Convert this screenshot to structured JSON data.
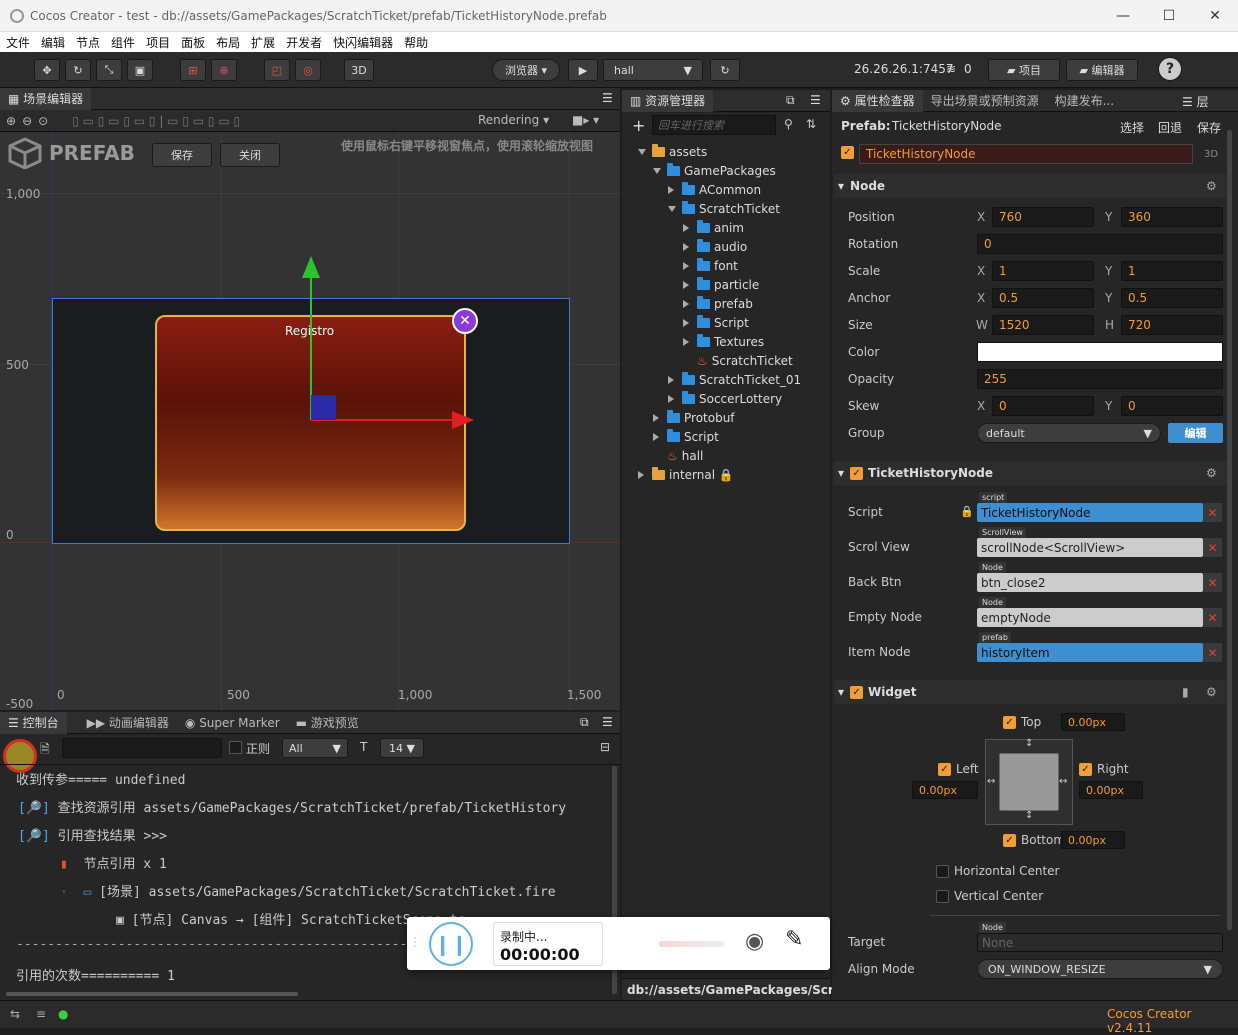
{
  "window": {
    "title": "Cocos Creator - test - db://assets/GamePackages/ScratchTicket/prefab/TicketHistoryNode.prefab"
  },
  "menu": [
    "文件",
    "编辑",
    "节点",
    "组件",
    "项目",
    "面板",
    "布局",
    "扩展",
    "开发者",
    "快闪编辑器",
    "帮助"
  ],
  "toolbar": {
    "mode3d": "3D",
    "browser": "浏览器",
    "scene_select": "hall",
    "ip": "26.26.26.1:7457",
    "wifi_count": "0",
    "project_btn": "项目",
    "editor_btn": "编辑器",
    "help": "?"
  },
  "scene_panel": {
    "tab": "场景编辑器",
    "rendering": "Rendering",
    "prefab_label": "PREFAB",
    "save": "保存",
    "close": "关闭",
    "hint": "使用鼠标右键平移视窗焦点，使用滚轮缩放视图",
    "axis_y": [
      "1,000",
      "500",
      "0",
      "-500"
    ],
    "axis_x": [
      "0",
      "500",
      "1,000",
      "1,500"
    ],
    "node_label": "Registro"
  },
  "console_panel": {
    "tabs": [
      "控制台",
      "动画编辑器",
      "Super Marker",
      "游戏预览"
    ],
    "regex": "正则",
    "filter": "All",
    "font_size": "14",
    "lines": [
      "收到传参===== undefined",
      "查找资源引用 assets/GamePackages/ScratchTicket/prefab/TicketHistory",
      "引用查找结果 >>>",
      "节点引用 x 1",
      "[场景] assets/GamePackages/ScratchTicket/ScratchTicket.fire",
      "[节点] Canvas  →  [组件] ScratchTicketScene.ts",
      "-------------------------------------------------------------",
      "引用的次数========== 1"
    ]
  },
  "assets_panel": {
    "tab": "资源管理器",
    "search_placeholder": "回车进行搜索",
    "tree": [
      "assets",
      "GamePackages",
      "ACommon",
      "ScratchTicket",
      "anim",
      "audio",
      "font",
      "particle",
      "prefab",
      "Script",
      "Textures",
      "ScratchTicket",
      "ScratchTicket_01",
      "SoccerLottery",
      "Protobuf",
      "Script",
      "hall",
      "internal"
    ],
    "footer": "db://assets/GamePackages/Scr..."
  },
  "inspector": {
    "tabs": [
      "属性检查器",
      "导出场景或预制资源",
      "构建发布..."
    ],
    "prefab_label": "Prefab:",
    "prefab_name": "TicketHistoryNode",
    "select": "选择",
    "revert": "回退",
    "save": "保存",
    "node_name": "TicketHistoryNode",
    "tag3d": "3D",
    "node_section": "Node",
    "position": {
      "label": "Position",
      "x": "760",
      "y": "360"
    },
    "rotation": {
      "label": "Rotation",
      "v": "0"
    },
    "scale": {
      "label": "Scale",
      "x": "1",
      "y": "1"
    },
    "anchor": {
      "label": "Anchor",
      "x": "0.5",
      "y": "0.5"
    },
    "size": {
      "label": "Size",
      "w": "1520",
      "h": "720"
    },
    "color": {
      "label": "Color"
    },
    "opacity": {
      "label": "Opacity",
      "v": "255"
    },
    "skew": {
      "label": "Skew",
      "x": "0",
      "y": "0"
    },
    "group": {
      "label": "Group",
      "v": "default",
      "edit": "编辑"
    },
    "comp_section": "TicketHistoryNode",
    "script": {
      "label": "Script",
      "tag": "script",
      "v": "TicketHistoryNode"
    },
    "scroll_view": {
      "label": "Scrol View",
      "tag": "ScrollView",
      "v": "scrollNode<ScrollView>"
    },
    "back_btn": {
      "label": "Back Btn",
      "tag": "Node",
      "v": "btn_close2"
    },
    "empty_node": {
      "label": "Empty Node",
      "tag": "Node",
      "v": "emptyNode"
    },
    "item_node": {
      "label": "Item Node",
      "tag": "prefab",
      "v": "historyItem"
    },
    "widget_section": "Widget",
    "widget": {
      "top": "Top",
      "top_v": "0.00px",
      "left": "Left",
      "left_v": "0.00px",
      "right": "Right",
      "right_v": "0.00px",
      "bottom": "Bottom",
      "bottom_v": "0.00px",
      "hcenter": "Horizontal Center",
      "vcenter": "Vertical Center"
    },
    "target": {
      "label": "Target",
      "tag": "Node",
      "v": "None"
    },
    "align_mode": {
      "label": "Align Mode",
      "v": "ON_WINDOW_RESIZE"
    }
  },
  "recorder": {
    "status": "录制中...",
    "time": "00:00:00"
  },
  "status": {
    "version": "Cocos Creator v2.4.11"
  },
  "colors": {
    "accent": "#f29d36",
    "selection_blue": "#3e8ed0",
    "node_card": "#7a1a0c"
  }
}
